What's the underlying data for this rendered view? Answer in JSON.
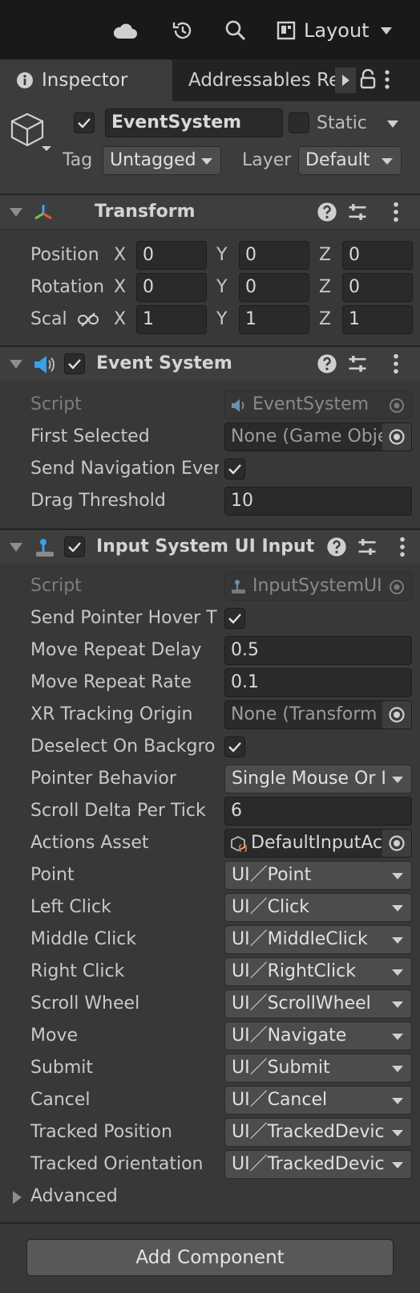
{
  "toolbar": {
    "layout_label": "Layout"
  },
  "tabs": {
    "inspector": "Inspector",
    "addressables": "Addressables Re"
  },
  "object": {
    "name": "EventSystem",
    "static_label": "Static",
    "tag_label": "Tag",
    "tag_value": "Untagged",
    "layer_label": "Layer",
    "layer_value": "Default"
  },
  "transform": {
    "title": "Transform",
    "position_label": "Position",
    "rotation_label": "Rotation",
    "scale_label": "Scal",
    "x": "X",
    "y": "Y",
    "z": "Z",
    "position": [
      "0",
      "0",
      "0"
    ],
    "rotation": [
      "0",
      "0",
      "0"
    ],
    "scale": [
      "1",
      "1",
      "1"
    ]
  },
  "event_system": {
    "title": "Event System",
    "script_label": "Script",
    "script_value": "EventSystem",
    "first_selected_label": "First Selected",
    "first_selected_value": "None (Game Obje",
    "send_nav_label": "Send Navigation Ever",
    "drag_threshold_label": "Drag Threshold",
    "drag_threshold_value": "10"
  },
  "input_module": {
    "title": "Input System UI Input M",
    "script_label": "Script",
    "script_value": "InputSystemUI",
    "send_pointer_label": "Send Pointer Hover T",
    "move_repeat_delay_label": "Move Repeat Delay",
    "move_repeat_delay_value": "0.5",
    "move_repeat_rate_label": "Move Repeat Rate",
    "move_repeat_rate_value": "0.1",
    "xr_origin_label": "XR Tracking Origin",
    "xr_origin_value": "None (Transform",
    "deselect_label": "Deselect On Backgro",
    "pointer_behavior_label": "Pointer Behavior",
    "pointer_behavior_value": "Single Mouse Or I",
    "scroll_delta_label": "Scroll Delta Per Tick",
    "scroll_delta_value": "6",
    "actions_asset_label": "Actions Asset",
    "actions_asset_value": "DefaultInputAc",
    "actions": [
      {
        "label": "Point",
        "value": "UI／Point"
      },
      {
        "label": "Left Click",
        "value": "UI／Click"
      },
      {
        "label": "Middle Click",
        "value": "UI／MiddleClick"
      },
      {
        "label": "Right Click",
        "value": "UI／RightClick"
      },
      {
        "label": "Scroll Wheel",
        "value": "UI／ScrollWheel"
      },
      {
        "label": "Move",
        "value": "UI／Navigate"
      },
      {
        "label": "Submit",
        "value": "UI／Submit"
      },
      {
        "label": "Cancel",
        "value": "UI／Cancel"
      },
      {
        "label": "Tracked Position",
        "value": "UI／TrackedDevic"
      },
      {
        "label": "Tracked Orientation",
        "value": "UI／TrackedDevic"
      }
    ],
    "advanced_label": "Advanced"
  },
  "add_component_label": "Add Component"
}
